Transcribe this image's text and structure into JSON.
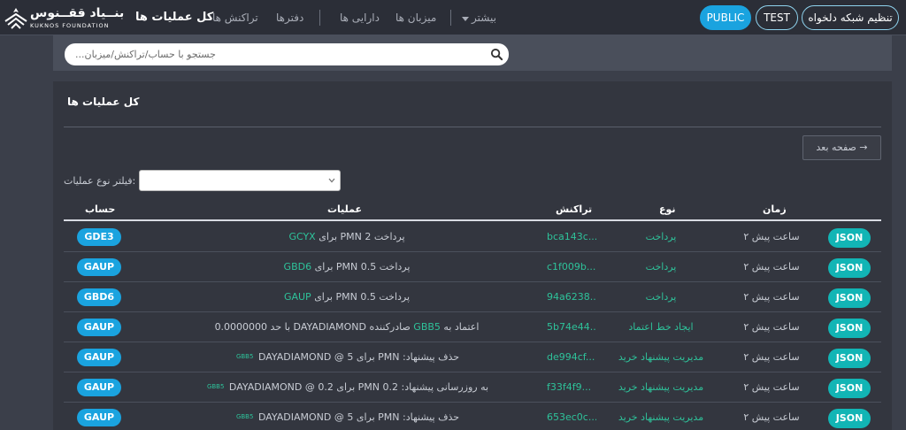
{
  "brand": {
    "name_fa": "بنــیاد ققــنوس",
    "name_en": "KUKNOS FOUNDATION"
  },
  "nav": {
    "all_ops": "کل عملیات ها",
    "transactions": "تراکنش ها",
    "ledgers": "دفترها",
    "assets": "دارایی ها",
    "hosts": "میزبان ها",
    "more": "بیشتر",
    "more_icon": "caret-down-icon"
  },
  "networks": {
    "public": "PUBLIC",
    "test": "TEST",
    "custom": "تنظیم شبکه دلخواه"
  },
  "search": {
    "placeholder": "جستجو با حساب/تراکنش/میزبان...",
    "value": ""
  },
  "panel": {
    "title": "کل عملیات ها",
    "next_button": "صفحه بعد →"
  },
  "filter": {
    "label": "فیلتر نوع عملیات:",
    "selected": ""
  },
  "table": {
    "headers": {
      "account": "حساب",
      "operation": "عملیات",
      "transaction": "تراکنش",
      "type": "نوع",
      "time": "زمان"
    },
    "rows": [
      {
        "account": "GDE3",
        "op_pre": "پرداخت 2 PMN برای",
        "op_link": "GCYX",
        "op_tag": "",
        "op_post": "",
        "tx": "bca143c...",
        "type": "پرداخت",
        "time": "ساعت پیش ۲",
        "json": "JSON"
      },
      {
        "account": "GAUP",
        "op_pre": "پرداخت 0.5 PMN برای",
        "op_link": "GBD6",
        "op_tag": "",
        "op_post": "",
        "tx": "c1f009b...",
        "type": "پرداخت",
        "time": "ساعت پیش ۲",
        "json": "JSON"
      },
      {
        "account": "GBD6",
        "op_pre": "پرداخت 0.5 PMN برای",
        "op_link": "GAUP",
        "op_tag": "",
        "op_post": "",
        "tx": "94a6238...",
        "type": "پرداخت",
        "time": "ساعت پیش ۲",
        "json": "JSON"
      },
      {
        "account": "GAUP",
        "op_pre": "اعتماد به",
        "op_link": "GBB5",
        "op_tag": "",
        "op_post": "صادرکننده DAYADIAMOND با حد 0.0000000",
        "tx": "5b74e44...",
        "type": "ایجاد خط اعتماد",
        "time": "ساعت پیش ۲",
        "json": "JSON"
      },
      {
        "account": "GAUP",
        "op_pre": "حذف پیشنهاد: PMN برای 5 @",
        "op_link": "",
        "op_tag": "GBB5",
        "op_post": "DAYADIAMOND",
        "tx": "de994cf...",
        "type": "مدیریت پیشنهاد خرید",
        "time": "ساعت پیش ۲",
        "json": "JSON"
      },
      {
        "account": "GAUP",
        "op_pre": "به روزرسانی پیشنهاد: 0.2 PMN برای 0.2 @",
        "op_link": "",
        "op_tag": "GBB5",
        "op_post": "DAYADIAMOND",
        "tx": "f33f4f9...",
        "type": "مدیریت پیشنهاد خرید",
        "time": "ساعت پیش ۲",
        "json": "JSON"
      },
      {
        "account": "GAUP",
        "op_pre": "حذف پیشنهاد: PMN برای 5 @",
        "op_link": "",
        "op_tag": "GBB5",
        "op_post": "DAYADIAMOND",
        "tx": "653ec0c...",
        "type": "مدیریت پیشنهاد خرید",
        "time": "ساعت پیش ۲",
        "json": "JSON"
      }
    ]
  },
  "colors": {
    "accent_blue": "#1aa3df",
    "json_teal": "#12b5b5",
    "link_green": "#2ec29a",
    "topbar": "#2b2e37",
    "panel": "#33363f"
  },
  "icons": {
    "search": "search-icon",
    "select": "chevron-down-icon",
    "logo": "kuknos-logo-icon"
  }
}
